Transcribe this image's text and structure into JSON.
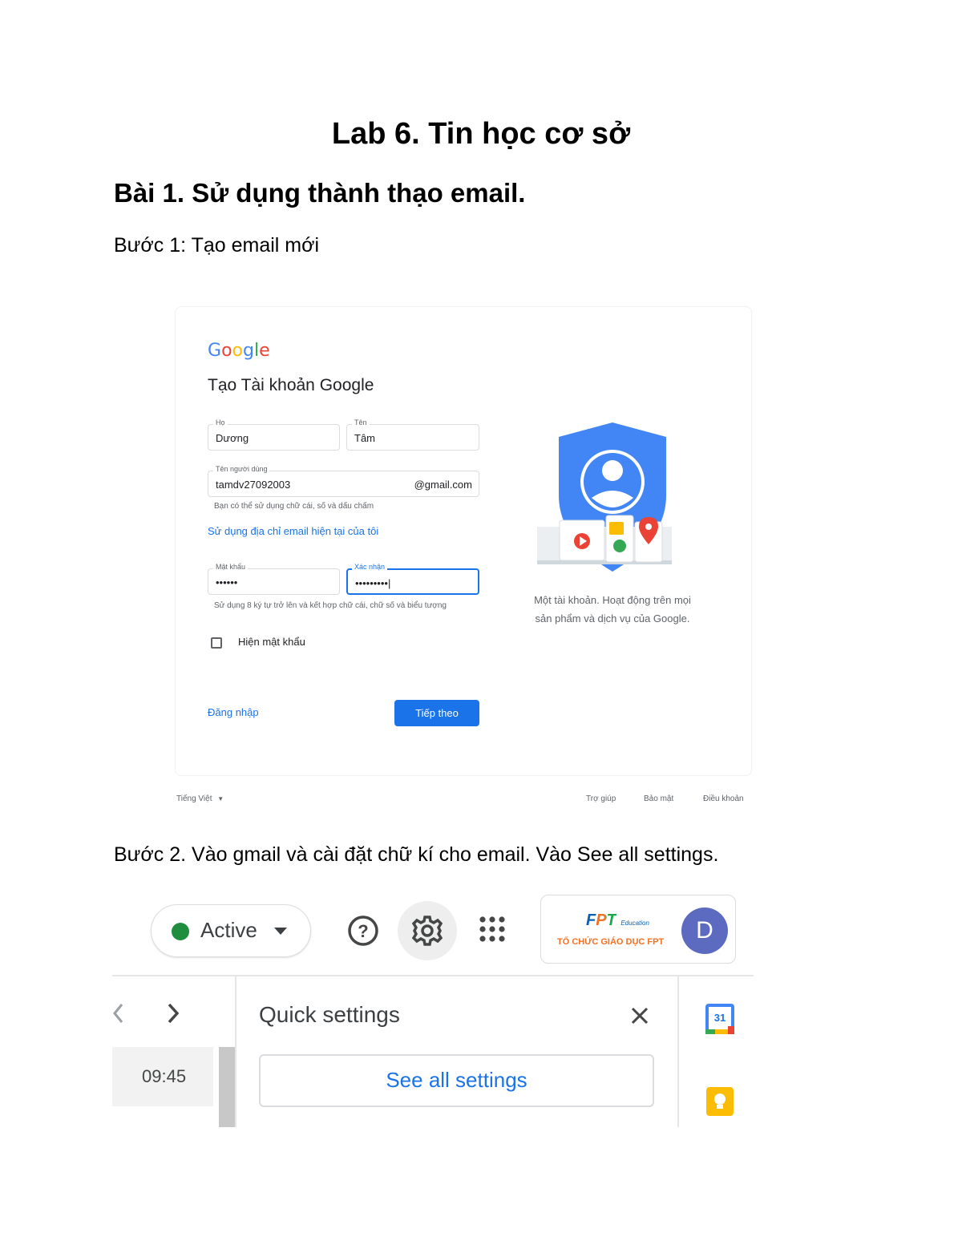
{
  "document": {
    "title": "Lab 6. Tin học cơ sở",
    "heading1": "Bài 1. Sử dụng thành thạo email.",
    "step1": "Bước 1: Tạo email mới",
    "step2": "Bước 2. Vào gmail và cài đặt chữ kí cho email. Vào See all settings."
  },
  "signup": {
    "logo": {
      "g1": "G",
      "o1": "o",
      "o2": "o",
      "g2": "g",
      "l": "l",
      "e": "e"
    },
    "heading": "Tạo Tài khoản Google",
    "last_name_label": "Họ",
    "last_name_value": "Dương",
    "first_name_label": "Tên",
    "first_name_value": "Tâm",
    "username_label": "Tên người dùng",
    "username_value": "tamdv27092003",
    "username_suffix": "@gmail.com",
    "username_hint": "Bạn có thể sử dụng chữ cái, số và dấu chấm",
    "use_existing_email": "Sử dụng địa chỉ email hiện tại của tôi",
    "password_label": "Mật khẩu",
    "password_value": "••••••",
    "confirm_label": "Xác nhận",
    "confirm_value": "•••••••••|",
    "password_hint": "Sử dụng 8 ký tự trở lên và kết hợp chữ cái, chữ số và biểu tượng",
    "show_password": "Hiện mật khẩu",
    "signin_link": "Đăng nhập",
    "next_button": "Tiếp theo",
    "caption_line1": "Một tài khoản. Hoạt động trên mọi",
    "caption_line2": "sản phẩm và dịch vụ của Google.",
    "footer_language": "Tiếng Việt",
    "footer_help": "Trợ giúp",
    "footer_privacy": "Bảo mật",
    "footer_terms": "Điều khoản",
    "colors": {
      "blue": "#1a73e8",
      "shield": "#4285F4"
    }
  },
  "gmail": {
    "status": "Active",
    "status_color": "#1e8e3e",
    "org_logo_text": "FPT",
    "org_logo_sub": "Education",
    "org_name": "TỔ CHỨC GIÁO DỤC FPT",
    "avatar_letter": "D",
    "avatar_color": "#5c6bc0",
    "time": "09:45",
    "quick_settings": "Quick settings",
    "see_all_settings": "See all settings",
    "calendar_day": "31",
    "icons": [
      "help-icon",
      "gear-icon",
      "apps-grid-icon",
      "chevron-left-icon",
      "chevron-right-icon",
      "close-icon",
      "calendar-icon",
      "keep-icon"
    ]
  }
}
